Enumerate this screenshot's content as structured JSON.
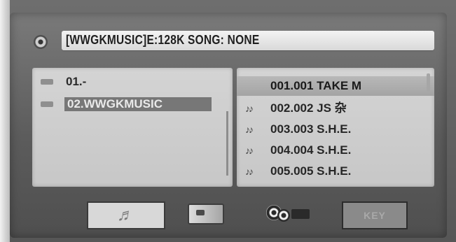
{
  "status": {
    "text": "[WWGKMUSIC]E:128K SONG: NONE",
    "icon": "disc-icon"
  },
  "folders": {
    "items": [
      {
        "label": "01.-",
        "icon": "folder-icon",
        "selected": false
      },
      {
        "label": "02.WWGKMUSIC",
        "icon": "folder-icon",
        "selected": true
      }
    ]
  },
  "songs": {
    "items": [
      {
        "label": "001.001 TAKE M",
        "icon": "",
        "highlighted": true
      },
      {
        "label": "002.002 JS 杂",
        "icon": "♪♪",
        "highlighted": false
      },
      {
        "label": "003.003 S.H.E.",
        "icon": "♪♪",
        "highlighted": false
      },
      {
        "label": "004.004 S.H.E.",
        "icon": "♪♪",
        "highlighted": false
      },
      {
        "label": "005.005 S.H.E.",
        "icon": "♪♪",
        "highlighted": false
      }
    ]
  },
  "tabs": {
    "music": {
      "icon": "music-icon",
      "active": true
    },
    "photo": {
      "icon": "photo-icon"
    },
    "video": {
      "icon": "video-icon"
    },
    "key": {
      "label": "KEY"
    }
  },
  "colors": {
    "screen": "#5c5c5c",
    "panel": "#d4d4d4",
    "selection": "#777777"
  }
}
